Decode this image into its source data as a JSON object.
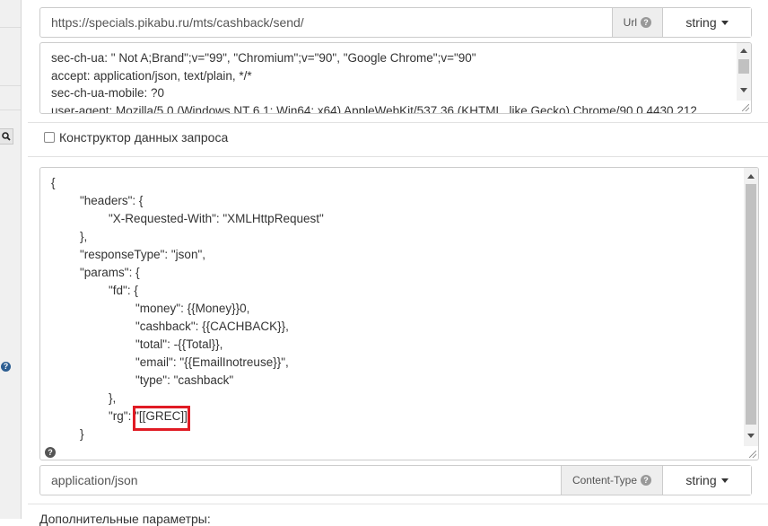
{
  "url": {
    "value": "https://specials.pikabu.ru/mts/cashback/send/",
    "addon_label": "Url",
    "type_label": "string"
  },
  "headers_text": [
    "sec-ch-ua: \" Not A;Brand\";v=\"99\", \"Chromium\";v=\"90\", \"Google Chrome\";v=\"90\"",
    "accept: application/json, text/plain, */*",
    "sec-ch-ua-mobile: ?0",
    "user-agent: Mozilla/5.0 (Windows NT 6.1; Win64; x64) AppleWebKit/537.36 (KHTML, like Gecko) Chrome/90.0.4430.212"
  ],
  "constructor_checkbox": {
    "label": "Конструктор данных запроса",
    "checked": false
  },
  "body_json": [
    "{",
    "\"headers\": {",
    "\"X-Requested-With\": \"XMLHttpRequest\"",
    "},",
    "\"responseType\": \"json\",",
    "\"params\": {",
    "\"fd\": {",
    "\"money\": {{Money}}0,",
    "\"cashback\": {{CACHBACK}},",
    "\"total\": -{{Total}},",
    "\"email\": \"{{EmailInotreuse}}\",",
    "\"type\": \"cashback\"",
    "},",
    "\"rg\": \"[[GREC]]",
    "}"
  ],
  "content_type": {
    "value": "application/json",
    "addon_label": "Content-Type",
    "type_label": "string"
  },
  "extra_params_label": "Дополнительные параметры:",
  "colors": {
    "highlight": "#e01b24"
  },
  "icons": {
    "left_search": "search-icon",
    "left_help": "question-icon",
    "body_help": "question-icon"
  }
}
